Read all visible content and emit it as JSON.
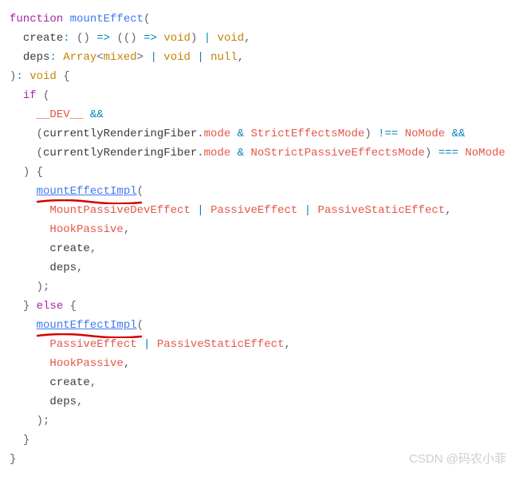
{
  "code": {
    "l1_kw": "function",
    "l1_fn": "mountEffect",
    "l1_open": "(",
    "l2_param": "create",
    "l2_void1": "void",
    "l2_or": "|",
    "l2_void2": "void",
    "l3_param": "deps",
    "l3_Array": "Array",
    "l3_mixed": "mixed",
    "l3_void": "void",
    "l3_null": "null",
    "l4_void": "void",
    "l5_if": "if",
    "l6_dev": "__DEV__",
    "l6_and": "&&",
    "l7_crf": "currentlyRenderingFiber",
    "l7_mode": "mode",
    "l7_amp": "&",
    "l7_sem": "StrictEffectsMode",
    "l7_neq": "!==",
    "l7_nomode": "NoMode",
    "l7_and": "&&",
    "l8_crf": "currentlyRenderingFiber",
    "l8_mode": "mode",
    "l8_amp": "&",
    "l8_nspem": "NoStrictPassiveEffectsMode",
    "l8_eqeq": "===",
    "l8_nomode": "NoMode",
    "l10_call": "mountEffectImpl",
    "l11_a": "MountPassiveDevEffect",
    "l11_b": "PassiveEffect",
    "l11_c": "PassiveStaticEffect",
    "l12_a": "HookPassive",
    "l13_a": "create",
    "l14_a": "deps",
    "l16_else": "else",
    "l17_call": "mountEffectImpl",
    "l18_a": "PassiveEffect",
    "l18_b": "PassiveStaticEffect",
    "l19_a": "HookPassive",
    "l20_a": "create",
    "l21_a": "deps"
  },
  "watermark": "CSDN @码农小菲"
}
